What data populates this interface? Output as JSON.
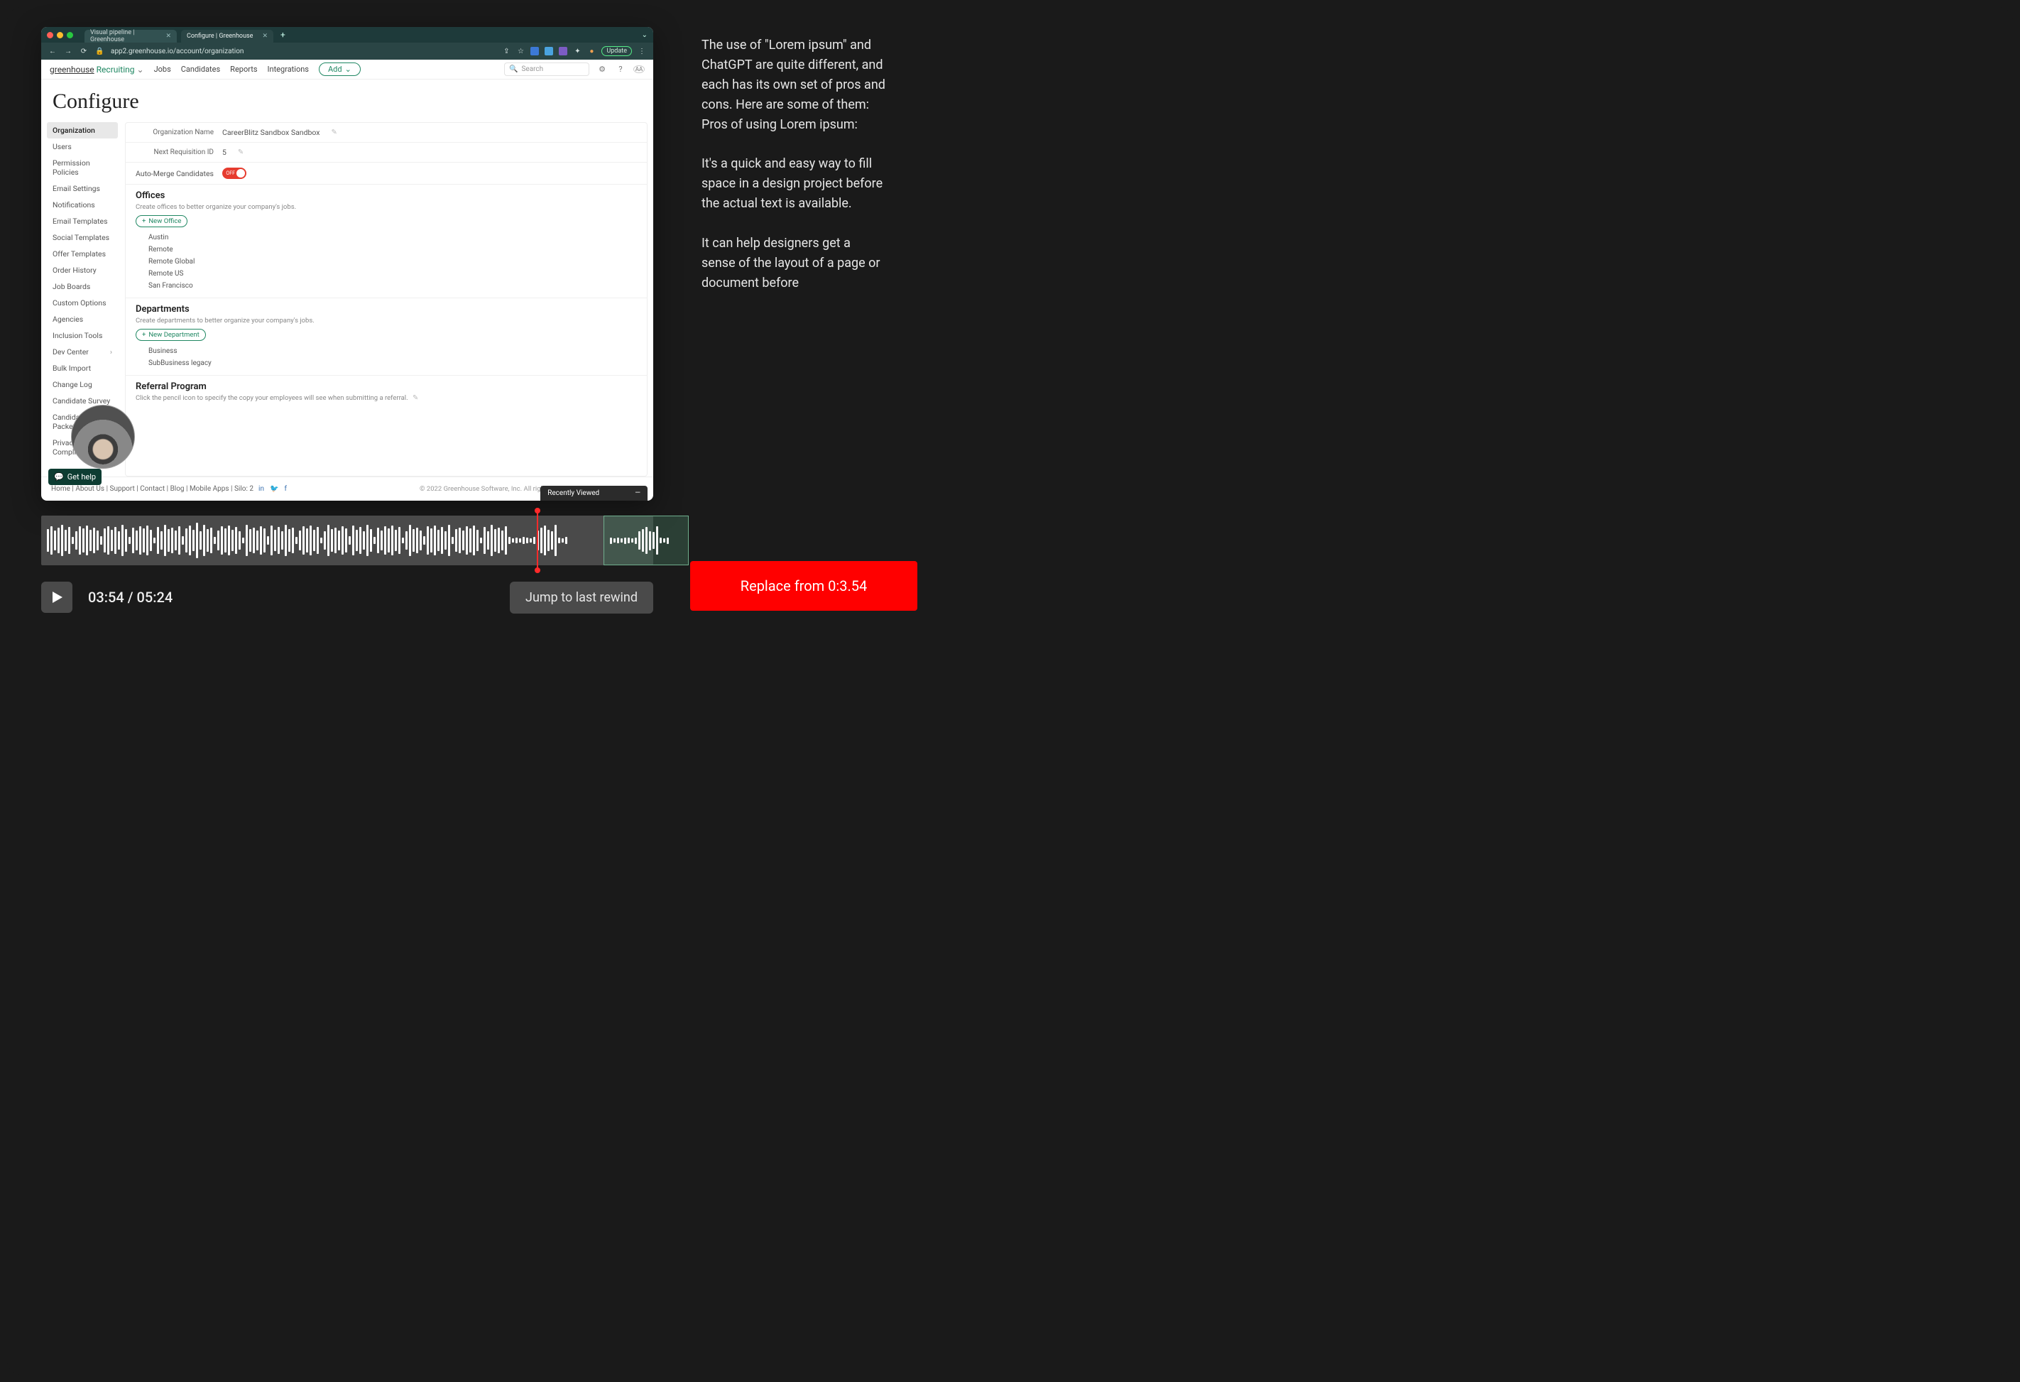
{
  "side_text": "The use of \"Lorem ipsum\" and ChatGPT are quite different, and each has its own set of pros and cons. Here are some of them: Pros of using Lorem ipsum:\n\nIt's a quick and easy way to fill space in a design project before the actual text is available.\n\nIt can help designers get a sense of the layout of a page or document before",
  "browser": {
    "tabs": [
      {
        "label": "Visual pipeline | Greenhouse",
        "active": false
      },
      {
        "label": "Configure | Greenhouse",
        "active": true
      }
    ],
    "url": "app2.greenhouse.io/account/organization",
    "update_label": "Update"
  },
  "header": {
    "brand_a": "greenhouse",
    "brand_b": "Recruiting",
    "links": [
      "Jobs",
      "Candidates",
      "Reports",
      "Integrations"
    ],
    "add": "Add",
    "search_placeholder": "Search"
  },
  "page_title": "Configure",
  "sidebar": {
    "items": [
      "Organization",
      "Users",
      "Permission Policies",
      "Email Settings",
      "Notifications",
      "Email Templates",
      "Social Templates",
      "Offer Templates",
      "Order History",
      "Job Boards",
      "Custom Options",
      "Agencies",
      "Inclusion Tools",
      "Dev Center",
      "Bulk Import",
      "Change Log",
      "Candidate Survey",
      "Candidate Packets",
      "Privacy & Compliance"
    ],
    "active_index": 0,
    "hasmore_index": 13
  },
  "content": {
    "org_name_label": "Organization Name",
    "org_name_value": "CareerBlitz Sandbox Sandbox",
    "req_label": "Next Requisition ID",
    "req_value": "5",
    "automerge_label": "Auto-Merge Candidates",
    "automerge_state": "OFF",
    "offices": {
      "title": "Offices",
      "desc": "Create offices to better organize your company's jobs.",
      "new": "New Office",
      "rows": [
        "Austin",
        "Remote",
        "Remote Global",
        "Remote US",
        "San Francisco"
      ]
    },
    "departments": {
      "title": "Departments",
      "desc": "Create departments to better organize your company's jobs.",
      "new": "New Department",
      "rows": [
        "Business",
        "SubBusiness legacy"
      ]
    },
    "referral": {
      "title": "Referral Program",
      "desc": "Click the pencil icon to specify the copy your employees will see when submitting a referral."
    }
  },
  "gethelp": "Get help",
  "footer": {
    "links": [
      "Home",
      "About Us",
      "Support",
      "Contact",
      "Blog",
      "Mobile Apps",
      "Silo: 2"
    ],
    "copyright": "© 2022 Greenhouse Software, Inc. All rights reserved."
  },
  "recently_viewed": "Recently Viewed",
  "controls": {
    "current": "03:54",
    "total": "05:24",
    "jump": "Jump to last rewind"
  },
  "replace": "Replace from 0:3.54",
  "waveform_heights": [
    32,
    40,
    28,
    36,
    44,
    30,
    38,
    10,
    26,
    40,
    34,
    42,
    30,
    36,
    28,
    12,
    34,
    40,
    30,
    38,
    26,
    44,
    32,
    10,
    36,
    28,
    40,
    34,
    42,
    30,
    8,
    38,
    26,
    44,
    32,
    36,
    28,
    40,
    12,
    34,
    42,
    30,
    50,
    26,
    44,
    32,
    36,
    10,
    28,
    40,
    34,
    42,
    30,
    38,
    26,
    8,
    44,
    32,
    36,
    28,
    40,
    34,
    12,
    42,
    30,
    38,
    26,
    44,
    32,
    36,
    10,
    28,
    40,
    34,
    42,
    30,
    38,
    8,
    26,
    44,
    32,
    36,
    28,
    40,
    34,
    12,
    42,
    30,
    38,
    26,
    44,
    32,
    10,
    36,
    28,
    40,
    34,
    42,
    30,
    38,
    8,
    26,
    44,
    32,
    36,
    28,
    12,
    40,
    34,
    42,
    30,
    38,
    26,
    44,
    10,
    32,
    36,
    28,
    40,
    34,
    42,
    30,
    8,
    38,
    26,
    44,
    32,
    36,
    28,
    40,
    10,
    6,
    8,
    6,
    10,
    8,
    6,
    10,
    28,
    36,
    42,
    30,
    26,
    44,
    8,
    6,
    10
  ]
}
